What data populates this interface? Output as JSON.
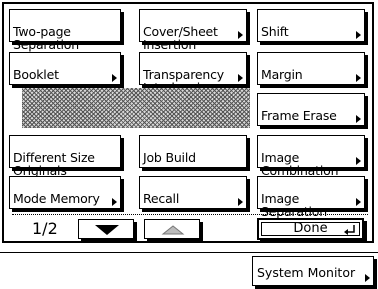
{
  "buttons": {
    "two_page_separation": "Two-page\nSeparation",
    "cover_sheet_insertion": "Cover/Sheet\nInsertion",
    "shift": "Shift",
    "booklet": "Booklet",
    "transparency_interleaving": "Transparency\nInterleaving",
    "margin": "Margin",
    "frame_erase": "Frame Erase",
    "different_size_originals": "Different Size\nOriginals",
    "job_build": "Job Build",
    "image_combination": "Image\nCombination",
    "mode_memory": "Mode Memory",
    "recall": "Recall",
    "image_separation": "Image\nSeparation"
  },
  "pager": {
    "page": "1/2"
  },
  "done_label": "Done",
  "system_monitor_label": "System Monitor",
  "colors": {
    "foreground": "#000000",
    "background": "#ffffff",
    "hatch": "#555555"
  },
  "icons": [
    "triangle-right-icon",
    "scroll-down-icon",
    "scroll-up-icon",
    "enter-icon"
  ]
}
